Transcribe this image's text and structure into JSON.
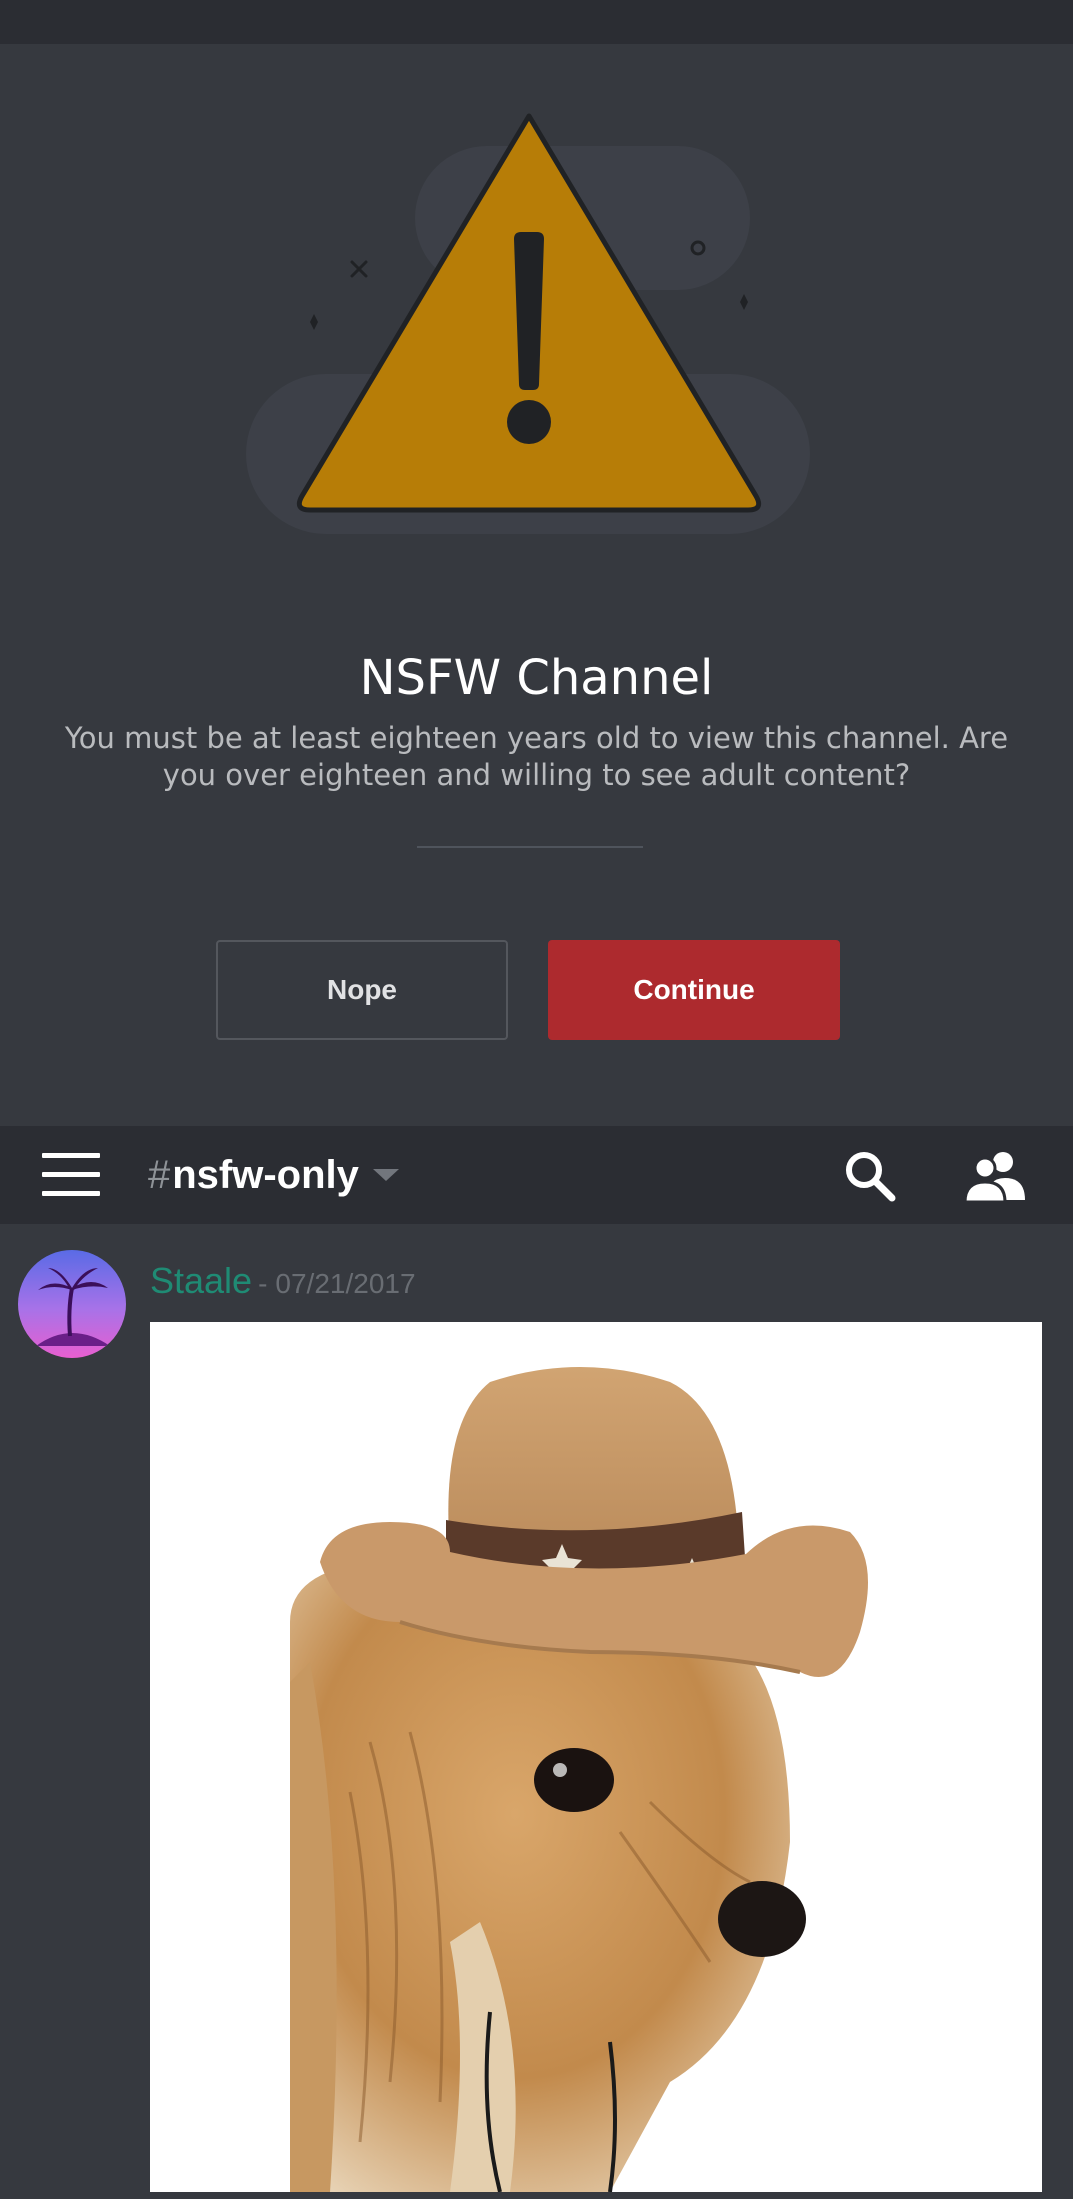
{
  "gate": {
    "title": "NSFW Channel",
    "description": "You must be at least eighteen years old to view this channel. Are you over eighteen and willing to see adult content?",
    "nope_label": "Nope",
    "continue_label": "Continue",
    "illustration_icon": "warning-triangle-icon"
  },
  "header": {
    "menu_icon": "hamburger-menu-icon",
    "channel_hash": "#",
    "channel_name": "nsfw-only",
    "search_icon": "search-icon",
    "members_icon": "members-icon"
  },
  "message": {
    "author": "Staale",
    "separator": "-",
    "timestamp": "07/21/2017",
    "attachment": "photo of a yorkshire terrier wearing a cowboy hat"
  },
  "colors": {
    "background": "#36393f",
    "header": "#2b2d33",
    "warning": "#b77d07",
    "continue_button": "#ad2a2e",
    "author": "#1f8b74"
  }
}
